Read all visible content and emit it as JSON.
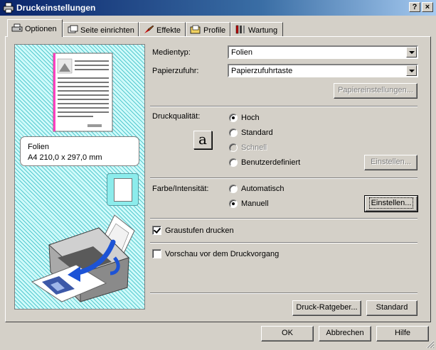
{
  "window": {
    "title": "Druckeinstellungen",
    "help_button": "?",
    "close_button": "×"
  },
  "tabs": [
    {
      "label": "Optionen",
      "icon": "printer-settings-icon",
      "active": true
    },
    {
      "label": "Seite einrichten",
      "icon": "page-setup-icon",
      "active": false
    },
    {
      "label": "Effekte",
      "icon": "effects-brush-icon",
      "active": false
    },
    {
      "label": "Profile",
      "icon": "profile-folder-icon",
      "active": false
    },
    {
      "label": "Wartung",
      "icon": "maintenance-tools-icon",
      "active": false
    }
  ],
  "preview": {
    "media_name": "Folien",
    "paper_size": "A4 210,0 x 297,0 mm"
  },
  "media": {
    "medientyp_label": "Medientyp:",
    "medientyp_value": "Folien",
    "papierzufuhr_label": "Papierzufuhr:",
    "papierzufuhr_value": "Papierzufuhrtaste",
    "papiereinstellungen_button": "Papiereinstellungen..."
  },
  "quality": {
    "label": "Druckqualität:",
    "icon_glyph": "a",
    "options": [
      {
        "label": "Hoch",
        "selected": true,
        "enabled": true
      },
      {
        "label": "Standard",
        "selected": false,
        "enabled": true
      },
      {
        "label": "Schnell",
        "selected": false,
        "enabled": false
      },
      {
        "label": "Benutzerdefiniert",
        "selected": false,
        "enabled": true
      }
    ],
    "einstellen_button": "Einstellen..."
  },
  "color": {
    "label": "Farbe/Intensität:",
    "options": [
      {
        "label": "Automatisch",
        "selected": false
      },
      {
        "label": "Manuell",
        "selected": true
      }
    ],
    "einstellen_button": "Einstellen..."
  },
  "grayscale": {
    "label": "Graustufen drucken",
    "checked": true
  },
  "preview_before_print": {
    "label": "Vorschau vor dem Druckvorgang",
    "checked": false
  },
  "footer": {
    "druck_ratgeber_button": "Druck-Ratgeber...",
    "standard_button": "Standard",
    "ok_button": "OK",
    "abbrechen_button": "Abbrechen",
    "hilfe_button": "Hilfe"
  },
  "colors": {
    "titlebar_start": "#0a246a",
    "titlebar_end": "#a6caf0",
    "dialog_face": "#d4d0c8",
    "preview_hatch": "#57c9cf",
    "preview_bg": "#cffafa"
  }
}
